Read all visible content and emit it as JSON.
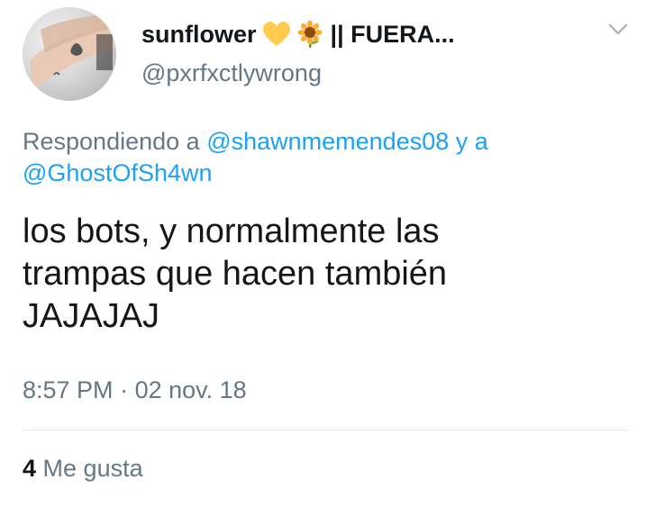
{
  "user": {
    "display_name": "sunflower",
    "name_suffix": "|| FUERA...",
    "handle": "@pxrfxctlywrong"
  },
  "reply": {
    "prefix": "Respondiendo a",
    "mention1": "@shawnmemendes08",
    "connector": "y a",
    "mention2": "@GhostOfSh4wn"
  },
  "tweet": {
    "lines": [
      "los bots, y normalmente las",
      "trampas que hacen también",
      "JAJAJAJ"
    ]
  },
  "meta": {
    "time": "8:57 PM",
    "separator": "·",
    "date": "02 nov. 18"
  },
  "stats": {
    "likes_count": "4",
    "likes_label": "Me gusta"
  },
  "icons": {
    "heart": "yellow-heart-emoji",
    "flower": "sunflower-emoji",
    "menu": "chevron-down-icon"
  },
  "colors": {
    "text": "#14171a",
    "secondary": "#657786",
    "link": "#1da1f2",
    "heart": "#ffcc4d",
    "divider": "#e1e8ed"
  }
}
